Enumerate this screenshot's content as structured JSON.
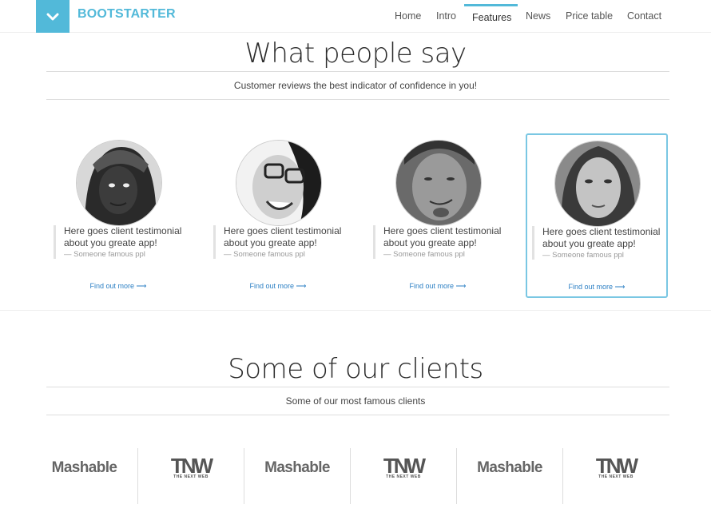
{
  "nav": {
    "brand": "BOOTSTARTER",
    "items": [
      {
        "label": "Home"
      },
      {
        "label": "Intro"
      },
      {
        "label": "Features"
      },
      {
        "label": "News"
      },
      {
        "label": "Price table"
      },
      {
        "label": "Contact"
      }
    ],
    "active": "Features"
  },
  "testimonials_section": {
    "title": "What people say",
    "subtitle": "Customer reviews the best indicator of confidence in you!",
    "cards": [
      {
        "text": "Here goes client testimonial about you greate app!",
        "author": "— Someone famous ppl",
        "link": "Find out more ⟶"
      },
      {
        "text": "Here goes client testimonial about you greate app!",
        "author": "— Someone famous ppl",
        "link": "Find out more ⟶"
      },
      {
        "text": "Here goes client testimonial about you greate app!",
        "author": "— Someone famous ppl",
        "link": "Find out more ⟶"
      },
      {
        "text": "Here goes client testimonial about you greate app!",
        "author": "— Someone famous ppl",
        "link": "Find out more ⟶"
      }
    ]
  },
  "clients_section": {
    "title": "Some of our clients",
    "subtitle": "Some of our most famous clients",
    "logos": [
      {
        "main": "Mashable"
      },
      {
        "main": "TNW",
        "sub": "THE NEXT WEB"
      },
      {
        "main": "Mashable"
      },
      {
        "main": "TNW",
        "sub": "THE NEXT WEB"
      },
      {
        "main": "Mashable"
      },
      {
        "main": "TNW",
        "sub": "THE NEXT WEB"
      }
    ]
  },
  "colors": {
    "accent": "#52b9d9",
    "link": "#2b7fc4",
    "highlight_border": "#7ac7e3"
  }
}
